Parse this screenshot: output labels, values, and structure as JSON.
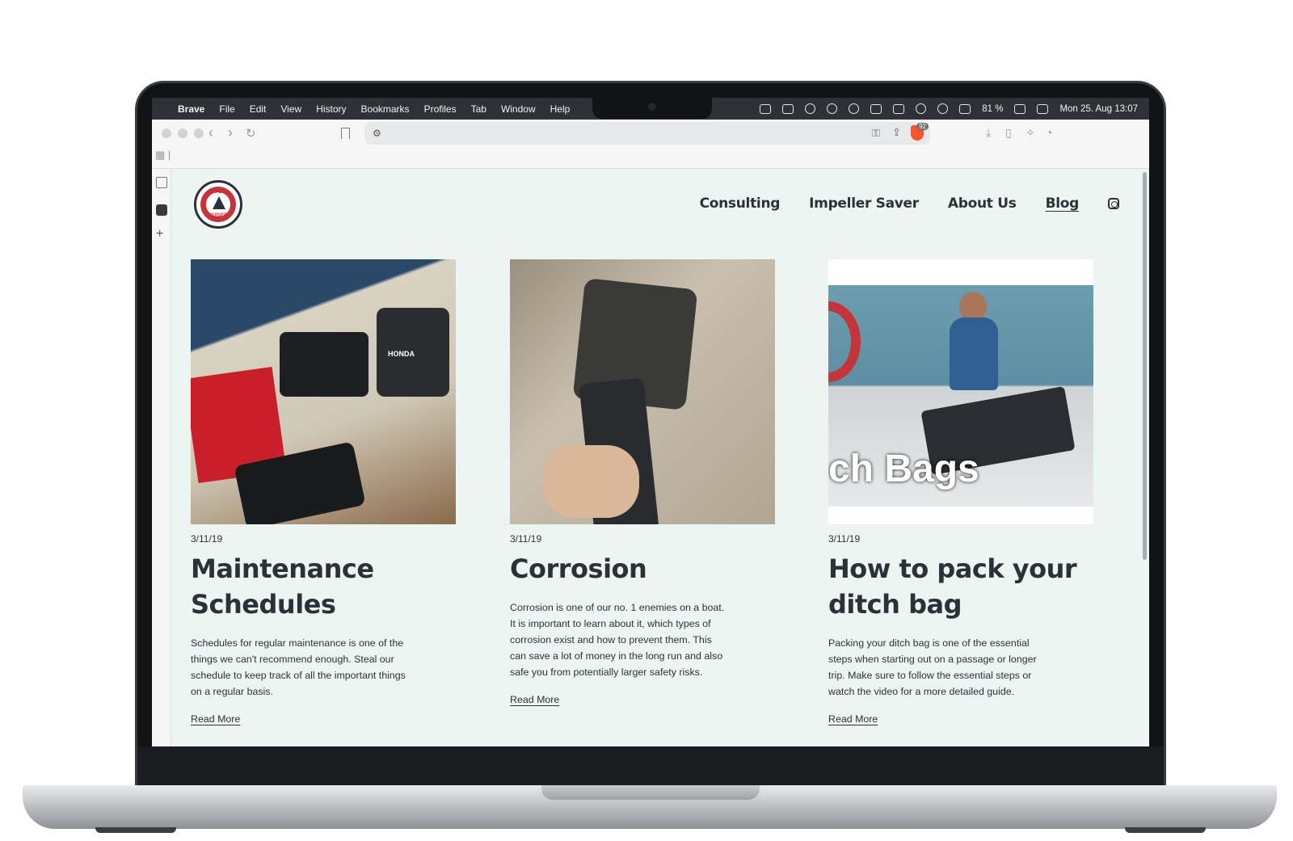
{
  "menubar": {
    "app_name": "Brave",
    "items": [
      "File",
      "Edit",
      "View",
      "History",
      "Bookmarks",
      "Profiles",
      "Tab",
      "Window",
      "Help"
    ],
    "battery": "81 %",
    "datetime": "Mon 25. Aug  13:07"
  },
  "browser": {
    "shield_count": "92"
  },
  "site": {
    "nav": [
      "Consulting",
      "Impeller Saver",
      "About Us",
      "Blog"
    ],
    "active_nav": "Blog",
    "logo_top": "SAFETY",
    "logo_bottom": "CRUISERS"
  },
  "posts": [
    {
      "date": "3/11/19",
      "title": "Maintenance Schedules",
      "excerpt": "Schedules for regular maintenance is one of the things we can't recommend enough. Steal our schedule to keep track of all the important things on a regular basis.",
      "link": "Read More",
      "image_text": "HONDA"
    },
    {
      "date": "3/11/19",
      "title": "Corrosion",
      "excerpt": "Corrosion is one of our no. 1 enemies on a boat. It is important to learn about it, which types of corrosion exist and how to prevent them. This can save a lot of money in the long run and also safe you from potentially larger safety risks.",
      "link": "Read More"
    },
    {
      "date": "3/11/19",
      "title": "How to pack your ditch bag",
      "excerpt": "Packing your ditch bag is one of the essential steps when starting out on a passage or longer trip. Make sure to follow the essential steps or watch the video for a more detailed guide.",
      "link": "Read More",
      "image_text": "ch Bags"
    }
  ]
}
